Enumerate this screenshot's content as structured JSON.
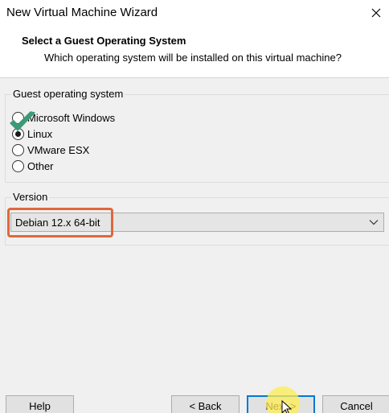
{
  "window": {
    "title": "New Virtual Machine Wizard",
    "close_icon": "close-icon"
  },
  "header": {
    "title": "Select a Guest Operating System",
    "subtitle": "Which operating system will be installed on this virtual machine?"
  },
  "guest_os": {
    "legend": "Guest operating system",
    "options": [
      {
        "label": "Microsoft Windows",
        "checked": false
      },
      {
        "label": "Linux",
        "checked": true
      },
      {
        "label": "VMware ESX",
        "checked": false
      },
      {
        "label": "Other",
        "checked": false
      }
    ]
  },
  "version": {
    "legend": "Version",
    "selected": "Debian 12.x 64-bit"
  },
  "buttons": {
    "help": "Help",
    "back": "< Back",
    "next": "Next >",
    "cancel": "Cancel"
  },
  "colors": {
    "highlight": "#e0673c",
    "checkmark": "#3c9a78",
    "cursor_glow": "#ffee50",
    "default_button_border": "#0078d7"
  }
}
